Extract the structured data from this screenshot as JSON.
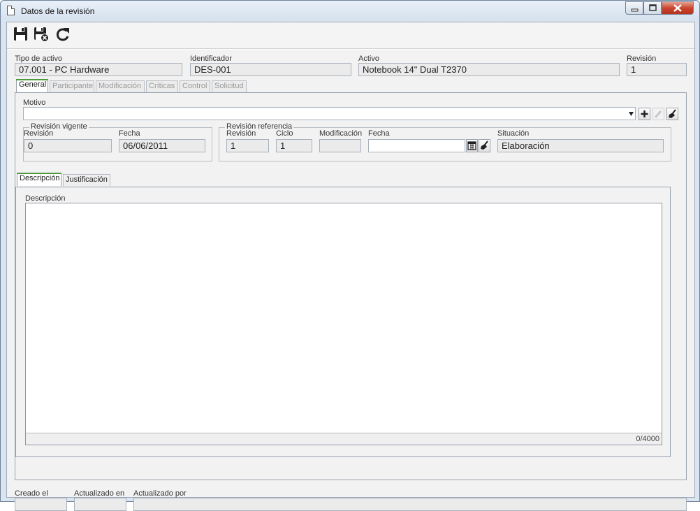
{
  "window": {
    "title": "Datos de la revisión"
  },
  "toolbar": {
    "buttons": [
      {
        "name": "save-button",
        "icon": "floppy-icon"
      },
      {
        "name": "save-close-button",
        "icon": "floppy-close-icon"
      },
      {
        "name": "refresh-button",
        "icon": "refresh-icon"
      }
    ]
  },
  "header": {
    "tipo_label": "Tipo de activo",
    "tipo_value": "07.001 - PC Hardware",
    "ident_label": "Identificador",
    "ident_value": "DES-001",
    "activo_label": "Activo",
    "activo_value": "Notebook 14\" Dual T2370",
    "revision_label": "Revisión",
    "revision_value": "1"
  },
  "tabs": [
    "General",
    "Participante",
    "Modificación",
    "Críticas",
    "Control",
    "Solicitud"
  ],
  "general": {
    "motivo_label": "Motivo",
    "motivo_value": "",
    "vigente": {
      "title": "Revisión vigente",
      "revision_label": "Revisión",
      "revision_value": "0",
      "fecha_label": "Fecha",
      "fecha_value": "06/06/2011"
    },
    "referencia": {
      "title": "Revisión referencia",
      "revision_label": "Revisión",
      "revision_value": "1",
      "ciclo_label": "Ciclo",
      "ciclo_value": "1",
      "modificacion_label": "Modificación",
      "modificacion_value": "",
      "fecha_label": "Fecha",
      "fecha_value": "",
      "situacion_label": "Situación",
      "situacion_value": "Elaboración"
    },
    "subtabs": [
      "Descripción",
      "Justificación"
    ],
    "descripcion_label": "Descripción",
    "descripcion_value": "",
    "counter": "0/4000"
  },
  "footer": {
    "creado_label": "Creado el",
    "creado_value": "",
    "actualizado_en_label": "Actualizado en",
    "actualizado_en_value": "",
    "actualizado_por_label": "Actualizado por",
    "actualizado_por_value": ""
  }
}
